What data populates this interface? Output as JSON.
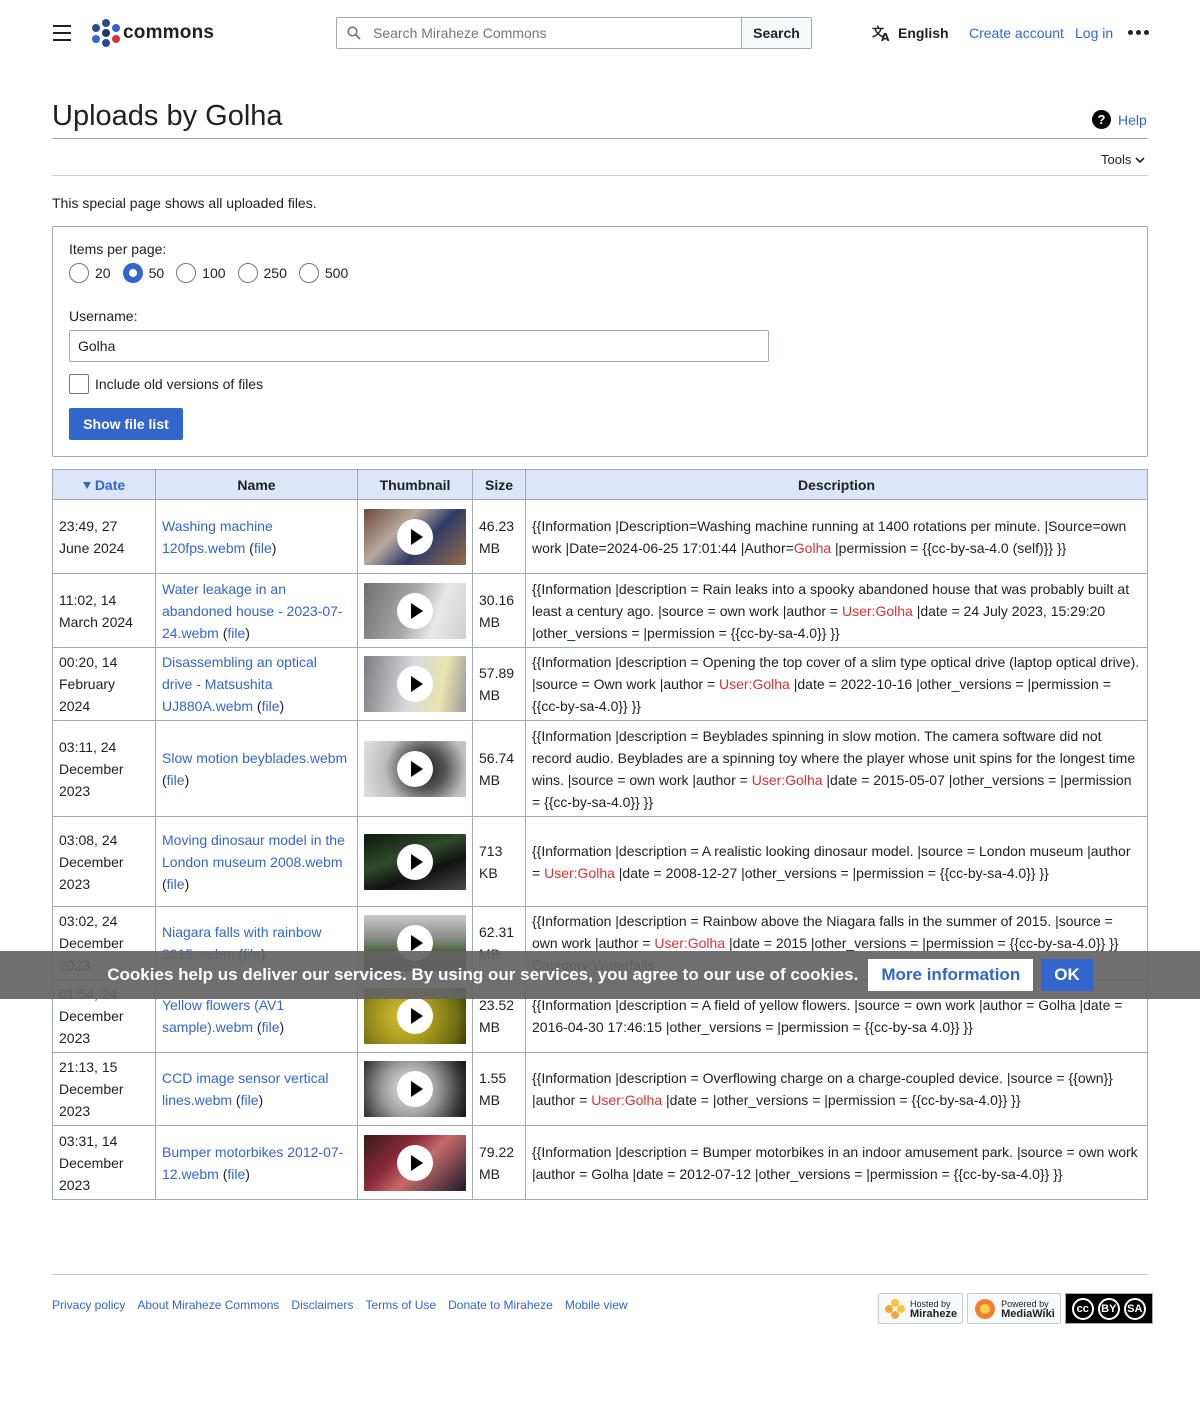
{
  "header": {
    "logo_text": "commons",
    "search_placeholder": "Search Miraheze Commons",
    "search_button": "Search",
    "language": "English",
    "create_account": "Create account",
    "login": "Log in"
  },
  "page": {
    "title": "Uploads by Golha",
    "help": "Help",
    "tools": "Tools",
    "intro": "This special page shows all uploaded files."
  },
  "form": {
    "items_label": "Items per page:",
    "options": [
      "20",
      "50",
      "100",
      "250",
      "500"
    ],
    "selected": "50",
    "username_label": "Username:",
    "username_value": "Golha",
    "old_versions_label": "Include old versions of files",
    "submit": "Show file list"
  },
  "table": {
    "headers": {
      "date": "Date",
      "name": "Name",
      "thumbnail": "Thumbnail",
      "size": "Size",
      "description": "Description"
    },
    "file_link": "file",
    "rows": [
      {
        "date": "23:49, 27 June 2024",
        "name": "Washing machine 120fps.webm",
        "size": "46.23 MB",
        "desc_a": "{{Information |Description=Washing machine running at 1400 rotations per minute. |Source=own work |Date=2024-06-25 17:01:44 |Author=",
        "desc_link": "Golha",
        "desc_b": " |permission = {{cc-by-sa-4.0 (self)}} }}"
      },
      {
        "date": "11:02, 14 March 2024",
        "name": "Water leakage in an abandoned house - 2023-07-24.webm",
        "size": "30.16 MB",
        "desc_a": "{{Information |description = Rain leaks into a spooky abandoned house that was probably built at least a century ago. |source = own work |author = ",
        "desc_link": "User:Golha",
        "desc_b": " |date = 24 July 2023, 15:29:20 |other_versions = |permission = {{cc-by-sa-4.0}} }}"
      },
      {
        "date": "00:20, 14 February 2024",
        "name": "Disassembling an optical drive - Matsushita UJ880A.webm",
        "size": "57.89 MB",
        "desc_a": "{{Information |description = Opening the top cover of a slim type optical drive (laptop optical drive). |source = Own work |author = ",
        "desc_link": "User:Golha",
        "desc_b": " |date = 2022-10-16 |other_versions = |permission = {{cc-by-sa-4.0}} }}"
      },
      {
        "date": "03:11, 24 December 2023",
        "name": "Slow motion beyblades.webm",
        "size": "56.74 MB",
        "desc_a": "{{Information |description = Beyblades spinning in slow motion. The camera software did not record audio. Beyblades are a spinning toy where the player whose unit spins for the longest time wins. |source = own work |author = ",
        "desc_link": "User:Golha",
        "desc_b": " |date = 2015-05-07 |other_versions = |permission = {{cc-by-sa-4.0}} }}"
      },
      {
        "date": "03:08, 24 December 2023",
        "name": "Moving dinosaur model in the London museum 2008.webm",
        "size": "713 KB",
        "desc_a": "{{Information |description = A realistic looking dinosaur model. |source = London museum |author = ",
        "desc_link": "User:Golha",
        "desc_b": " |date = 2008-12-27 |other_versions = |permission = {{cc-by-sa-4.0}} }}"
      },
      {
        "date": "03:02, 24 December 2023",
        "name": "Niagara falls with rainbow 2015.webm",
        "size": "62.31 MB",
        "desc_a": "{{Information |description = Rainbow above the Niagara falls in the summer of 2015. |source = own work |author = ",
        "desc_link": "User:Golha",
        "desc_b": " |date = 2015 |other_versions = |permission = {{cc-by-sa-4.0}} }} Category:Waterfalls"
      },
      {
        "date": "01:54, 24 December 2023",
        "name": "Yellow flowers (AV1 sample).webm",
        "size": "23.52 MB",
        "desc_a": "{{Information |description = A field of yellow flowers. |source = own work |author = Golha |date = 2016-04-30 17:46:15 |other_versions = |permission = {{cc-by-sa 4.0}} }}",
        "desc_link": "",
        "desc_b": ""
      },
      {
        "date": "21:13, 15 December 2023",
        "name": "CCD image sensor vertical lines.webm",
        "size": "1.55 MB",
        "desc_a": "{{Information |description = Overflowing charge on a charge-coupled device. |source = {{own}} |author = ",
        "desc_link": "User:Golha",
        "desc_b": " |date = |other_versions = |permission = {{cc-by-sa-4.0}} }}"
      },
      {
        "date": "03:31, 14 December 2023",
        "name": "Bumper motorbikes 2012-07-12.webm",
        "size": "79.22 MB",
        "desc_a": "{{Information |description = Bumper motorbikes in an indoor amusement park. |source = own work |author = Golha |date = 2012-07-12 |other_versions = |permission = {{cc-by-sa-4.0}} }}",
        "desc_link": "",
        "desc_b": ""
      }
    ]
  },
  "cookie": {
    "message": "Cookies help us deliver our services. By using our services, you agree to our use of cookies.",
    "more": "More information",
    "ok": "OK"
  },
  "footer": {
    "links": [
      "Privacy policy",
      "About Miraheze Commons",
      "Disclaimers",
      "Terms of Use",
      "Donate to Miraheze",
      "Mobile view"
    ],
    "hosted_by": "Hosted by",
    "hosted_name": "Miraheze",
    "powered_by": "Powered by",
    "powered_name": "MediaWiki",
    "cc_by": "BY",
    "cc_sa": "SA"
  },
  "icons": [
    "menu-icon",
    "search-icon",
    "translate-icon",
    "more-icon",
    "help-icon",
    "chevron-down-icon",
    "play-icon",
    "cc-icon"
  ],
  "colors": {
    "link": "#3366cc",
    "redlink": "#d73333",
    "header_bg": "#dde6f8",
    "primary": "#3366cc"
  }
}
